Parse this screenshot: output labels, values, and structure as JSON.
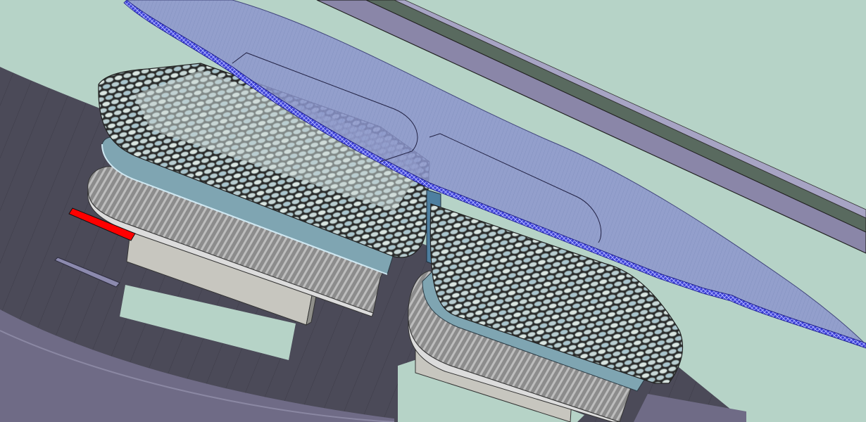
{
  "viewport": {
    "background": "#b6d3c7",
    "colors": {
      "ground": "#4b4a58",
      "ground_edge": "#7e7b92",
      "roof_panel": "#8590c8",
      "roof_edge": "#3b3fd6",
      "rail_dark": "#596a5f",
      "rail_light": "#8a86a8",
      "facade": "#8a8a8a",
      "glass_band": "#7aa6b4",
      "plinth": "#bdbdb8",
      "red_marker": "#ff0000",
      "blue_panel": "#4e7fa0",
      "mesh_light": "#dce6e2",
      "mesh_dark": "#2c2c2c"
    },
    "elements": [
      "ground-slab",
      "road-strip",
      "canopy-roof",
      "roof-rail",
      "left-building",
      "right-building",
      "red-marker"
    ]
  }
}
